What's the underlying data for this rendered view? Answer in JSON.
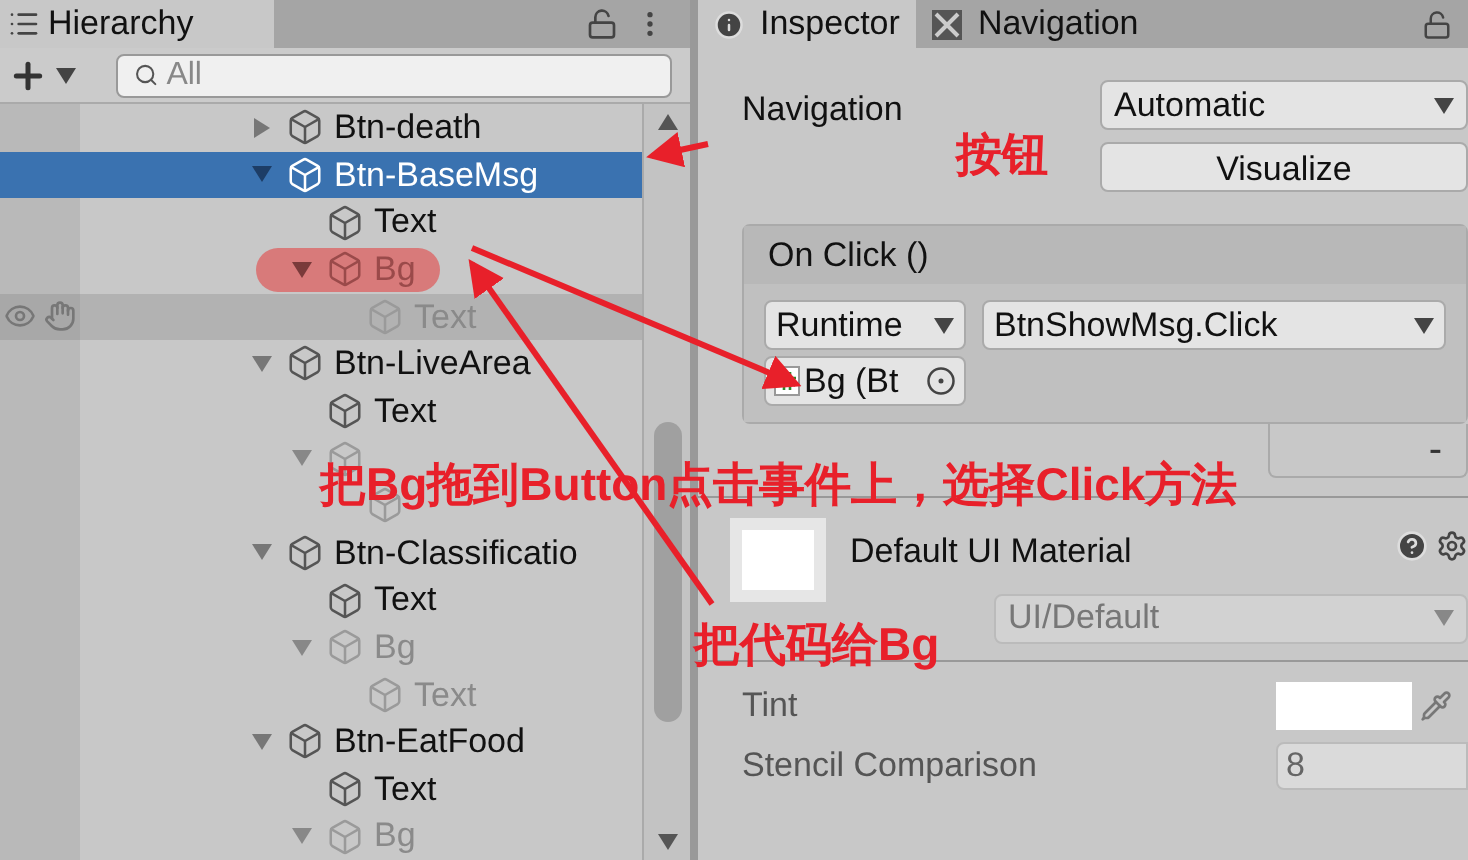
{
  "hierarchy": {
    "title": "Hierarchy",
    "search": {
      "placeholder": "All"
    },
    "tree": [
      {
        "name": "Btn-death",
        "active": true,
        "expanded": false,
        "selected": false,
        "marked": false,
        "hovered": false
      },
      {
        "name": "Btn-BaseMsg",
        "active": true,
        "expanded": true,
        "selected": true,
        "marked": false,
        "hovered": false,
        "children": [
          {
            "name": "Text",
            "active": true,
            "selected": false,
            "marked": false,
            "hovered": false
          },
          {
            "name": "Bg",
            "active": false,
            "expanded": true,
            "selected": false,
            "marked": true,
            "hovered": false,
            "children": [
              {
                "name": "Text",
                "active": false,
                "selected": false,
                "marked": false,
                "hovered": true
              }
            ]
          }
        ]
      },
      {
        "name": "Btn-LiveArea",
        "active": true,
        "expanded": true,
        "selected": false,
        "marked": false,
        "hovered": false,
        "children": [
          {
            "name": "Text",
            "active": true,
            "selected": false,
            "marked": false,
            "hovered": false
          },
          {
            "active": false,
            "expanded": true,
            "selected": false,
            "marked": false,
            "hovered": false,
            "children": [
              {
                "active": false,
                "selected": false,
                "marked": false,
                "hovered": false
              }
            ]
          }
        ]
      },
      {
        "name": "Btn-Classificatio",
        "active": true,
        "expanded": true,
        "selected": false,
        "marked": false,
        "hovered": false,
        "children": [
          {
            "name": "Text",
            "active": true,
            "selected": false,
            "marked": false,
            "hovered": false
          },
          {
            "name": "Bg",
            "active": false,
            "expanded": true,
            "selected": false,
            "marked": false,
            "hovered": false,
            "children": [
              {
                "name": "Text",
                "active": false,
                "selected": false,
                "marked": false,
                "hovered": false
              }
            ]
          }
        ]
      },
      {
        "name": "Btn-EatFood",
        "active": true,
        "expanded": true,
        "selected": false,
        "marked": false,
        "hovered": false,
        "children": [
          {
            "name": "Text",
            "active": true,
            "selected": false,
            "marked": false,
            "hovered": false
          },
          {
            "name": "Bg",
            "active": false,
            "expanded": true,
            "selected": false,
            "marked": false,
            "hovered": false
          }
        ]
      }
    ]
  },
  "inspector": {
    "tabs": [
      {
        "label": "Inspector",
        "selected": true
      },
      {
        "label": "Navigation",
        "selected": false
      }
    ],
    "navigation": {
      "label": "Navigation",
      "value": "Automatic",
      "button": "Visualize"
    },
    "on_click": {
      "title": "On Click ()",
      "entries": [
        {
          "mode": "Runtime",
          "function": "BtnShowMsg.Click",
          "object": "Bg (Bt"
        }
      ],
      "remove_button": "-"
    },
    "material": {
      "name": "Default UI Material",
      "shader": "UI/Default",
      "properties": [
        {
          "kind": "color",
          "label": "Tint",
          "color": "#ffffff"
        },
        {
          "kind": "number",
          "label": "Stencil Comparison",
          "value": "8"
        }
      ]
    }
  },
  "annotations": [
    {
      "text": "按钮"
    },
    {
      "text": "把Bg拖到Button点击事件上，选择Click方法"
    },
    {
      "text": "把代码给Bg"
    }
  ]
}
